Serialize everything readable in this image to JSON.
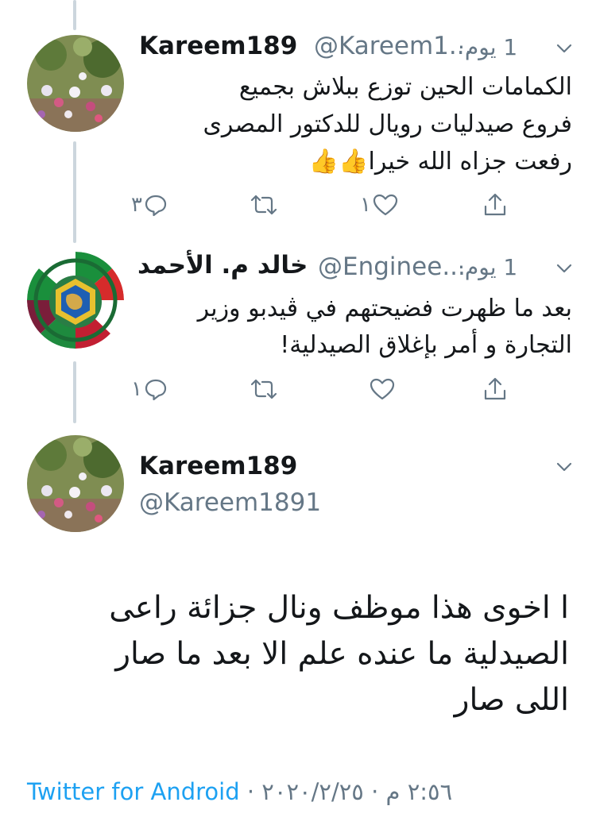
{
  "colors": {
    "accent": "#1da1f2",
    "muted": "#657786",
    "text": "#14171a",
    "thread_line": "#ccd6dd"
  },
  "replies": [
    {
      "name": "Kareem189",
      "handle": "@Kareem1...",
      "time": "1 يوم",
      "lines": [
        "الكمامات الحين توزع ببلاش بجميع",
        "فروع صيدليات رويال للدكتور المصرى",
        "رفعت جزاه الله خيرا👍👍"
      ],
      "replies_count": "٣",
      "likes_count": "١"
    },
    {
      "name": "خالد م. الأحمد",
      "handle": "@Enginee...",
      "time": "1 يوم",
      "lines": [
        "بعد ما ظهرت فضيحتهم في ڤيدبو وزير",
        "التجارة و أمر بإغلاق الصيدلية!"
      ],
      "replies_count": "١",
      "likes_count": ""
    }
  ],
  "main": {
    "name": "Kareem189",
    "handle": "@Kareem1891",
    "lines": [
      "ا اخوى هذا موظف ونال جزائة راعى",
      "الصيدلية ما عنده علم الا بعد ما صار",
      "اللى صار"
    ],
    "source": "Twitter for Android",
    "datetime": "٢:٥٦ م · ٢٠٢٠/٢/٢٥"
  },
  "icons": [
    "reply-icon",
    "retweet-icon",
    "like-icon",
    "share-icon",
    "chevron-down-icon"
  ]
}
